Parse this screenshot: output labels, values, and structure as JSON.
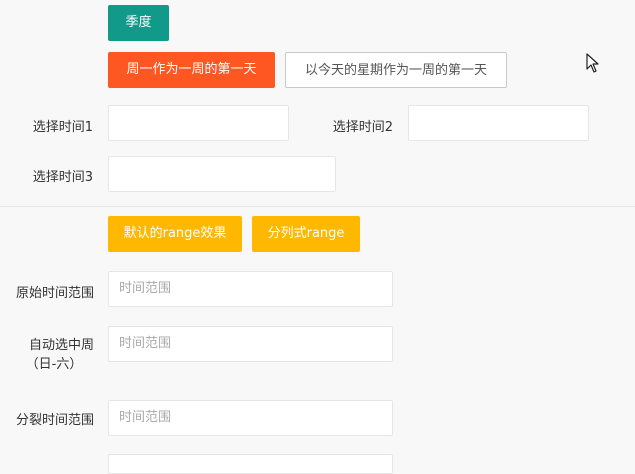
{
  "buttons": {
    "season": "季度",
    "monday_first": "周一作为一周的第一天",
    "today_first": "以今天的星期作为一周的第一天",
    "default_range": "默认的range效果",
    "split_range": "分列式range"
  },
  "form_top": {
    "time1_label": "选择时间1",
    "time2_label": "选择时间2",
    "time3_label": "选择时间3"
  },
  "form_range": {
    "original_label": "原始时间范围",
    "auto_week_label_line1": "自动选中周",
    "auto_week_label_line2": "（日-六）",
    "split_label": "分裂时间范围",
    "placeholder": "时间范围"
  },
  "colors": {
    "teal": "#119a8a",
    "red": "#ff5722",
    "yellow": "#ffb800"
  },
  "icons": {
    "cursor": "mouse-pointer-icon"
  }
}
